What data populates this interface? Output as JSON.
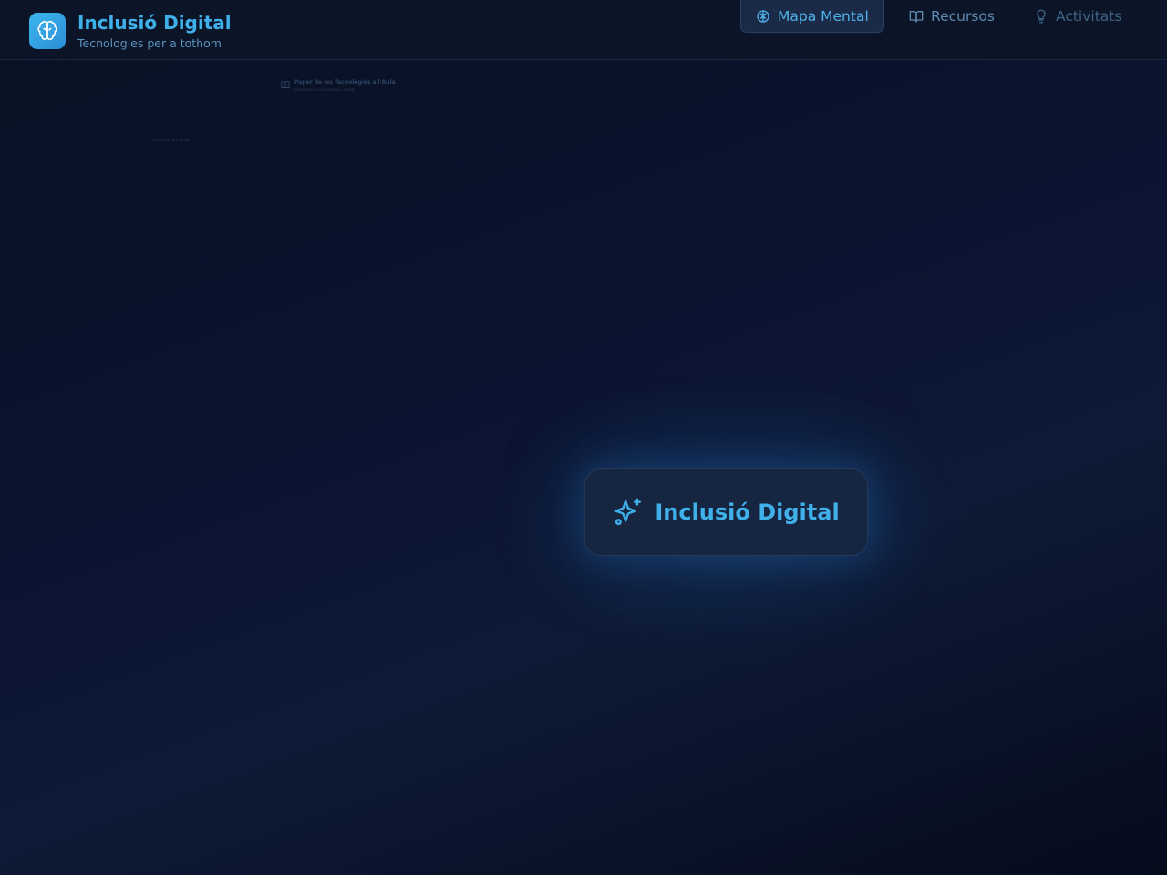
{
  "app": {
    "title": "Inclusió Digital",
    "subtitle": "Tecnologies per a tothom",
    "logo_icon": "brain-icon",
    "accent_color": "#3fb0ea"
  },
  "nav": {
    "items": [
      {
        "label": "Mapa Mental",
        "icon": "brain-icon",
        "active": true
      },
      {
        "label": "Recursos",
        "icon": "book-open-icon",
        "active": false
      },
      {
        "label": "Activitats",
        "icon": "lightbulb-icon",
        "active": false
      }
    ]
  },
  "mind_map": {
    "central": {
      "label": "Inclusió Digital",
      "icon": "sparkles-icon"
    },
    "faint_nodes": [
      {
        "title": "Paper de les Tecnologies a l'Aula",
        "subtitle": "Inmpazéus Foundation, 2018",
        "icon": "book-open-icon"
      },
      {
        "title": "Fomentar la inclusió",
        "icon": "arrow-icon"
      }
    ]
  }
}
